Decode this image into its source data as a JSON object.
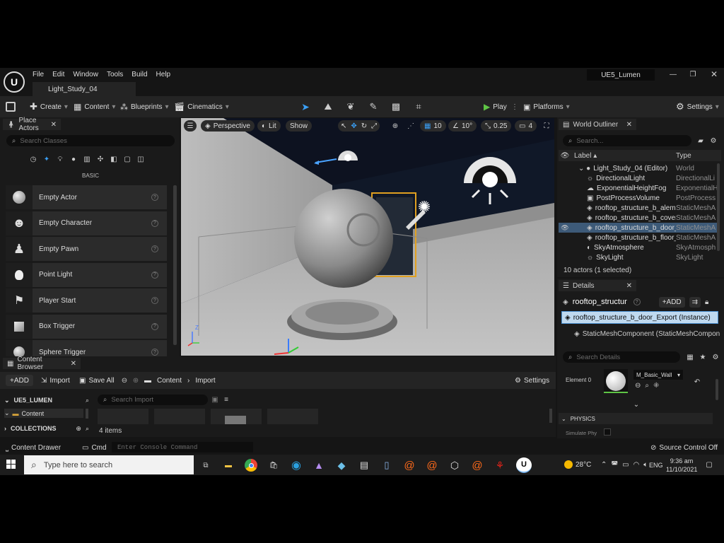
{
  "menu": [
    "File",
    "Edit",
    "Window",
    "Tools",
    "Build",
    "Help"
  ],
  "project_name": "UE5_Lumen",
  "level_tab": "Light_Study_04",
  "toolbar": {
    "create": "Create",
    "content": "Content",
    "blueprints": "Blueprints",
    "cinematics": "Cinematics",
    "play": "Play",
    "platforms": "Platforms",
    "settings": "Settings"
  },
  "place_actors": {
    "tab": "Place Actors",
    "search_placeholder": "Search Classes",
    "category": "BASIC",
    "items": [
      {
        "label": "Empty Actor",
        "icon": "sphere-icon"
      },
      {
        "label": "Empty Character",
        "icon": "character-icon"
      },
      {
        "label": "Empty Pawn",
        "icon": "pawn-icon"
      },
      {
        "label": "Point Light",
        "icon": "lightbulb-icon"
      },
      {
        "label": "Player Start",
        "icon": "flag-icon"
      },
      {
        "label": "Box Trigger",
        "icon": "box-icon"
      },
      {
        "label": "Sphere Trigger",
        "icon": "sphere-icon"
      }
    ]
  },
  "viewport": {
    "perspective": "Perspective",
    "lit": "Lit",
    "show": "Show",
    "grid": "10",
    "angle": "10°",
    "scale": "0.25",
    "camera": "4",
    "axis_z": "Z"
  },
  "outliner": {
    "tab": "World Outliner",
    "search_placeholder": "Search...",
    "col_label": "Label ▴",
    "col_type": "Type",
    "rows": [
      {
        "label": "Light_Study_04 (Editor)",
        "type": "World"
      },
      {
        "label": "DirectionalLight",
        "type": "DirectionalLi"
      },
      {
        "label": "ExponentialHeightFog",
        "type": "ExponentialH"
      },
      {
        "label": "PostProcessVolume",
        "type": "PostProcess"
      },
      {
        "label": "rooftop_structure_b_alem",
        "type": "StaticMeshA"
      },
      {
        "label": "rooftop_structure_b_cover",
        "type": "StaticMeshA"
      },
      {
        "label": "rooftop_structure_b_door_",
        "type": "StaticMeshA"
      },
      {
        "label": "rooftop_structure_b_floor_",
        "type": "StaticMeshA"
      },
      {
        "label": "SkyAtmosphere",
        "type": "SkyAtmosph"
      },
      {
        "label": "SkyLight",
        "type": "SkyLight"
      }
    ],
    "selected_row": 6,
    "status": "10 actors (1 selected)"
  },
  "details": {
    "tab": "Details",
    "name": "rooftop_structur",
    "add": "+ADD",
    "instance": "rooftop_structure_b_door_Export (Instance)",
    "component": "StaticMeshComponent (StaticMeshCompone",
    "search_placeholder": "Search Details",
    "element_label": "Element 0",
    "material": "M_Basic_Wall",
    "physics": "PHYSICS",
    "simulate": "Simulate Phy"
  },
  "content_browser": {
    "tab": "Content Browser",
    "add": "+ADD",
    "import": "Import",
    "save_all": "Save All",
    "path": [
      "Content",
      "Import"
    ],
    "settings": "Settings",
    "project": "UE5_LUMEN",
    "folder": "Content",
    "collections": "COLLECTIONS",
    "search_placeholder": "Search Import",
    "count": "4 items"
  },
  "bottom_bar": {
    "drawer": "Content Drawer",
    "cmd": "Cmd",
    "console_placeholder": "Enter Console Command",
    "source_control": "Source Control Off"
  },
  "taskbar": {
    "search_placeholder": "Type here to search",
    "temp": "28°C",
    "lang": "ENG",
    "time": "9:36 am",
    "date": "11/10/2021"
  }
}
